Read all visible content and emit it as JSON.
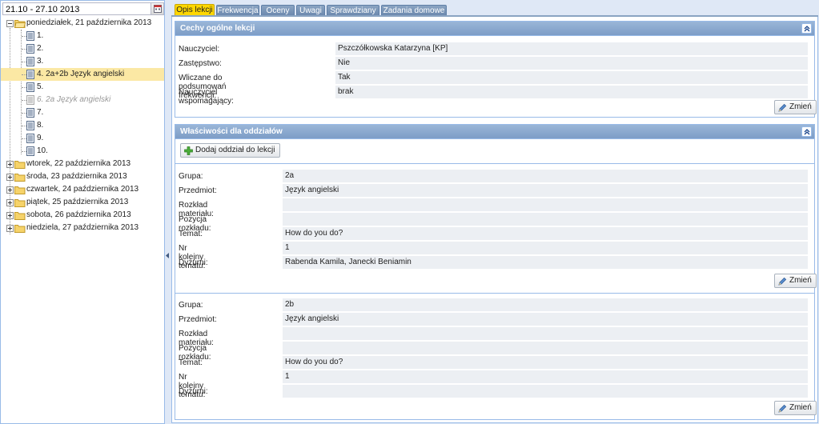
{
  "week": {
    "range": "21.10 - 27.10 2013"
  },
  "tree": {
    "days": [
      {
        "label": "poniedziałek, 21 października 2013",
        "expanded": true
      },
      {
        "label": "wtorek, 22 października 2013",
        "expanded": false
      },
      {
        "label": "środa, 23 października 2013",
        "expanded": false
      },
      {
        "label": "czwartek, 24 października 2013",
        "expanded": false
      },
      {
        "label": "piątek, 25 października 2013",
        "expanded": false
      },
      {
        "label": "sobota, 26 października 2013",
        "expanded": false
      },
      {
        "label": "niedziela, 27 października 2013",
        "expanded": false
      }
    ],
    "lessons": [
      {
        "label": "1."
      },
      {
        "label": "2."
      },
      {
        "label": "3."
      },
      {
        "label": "4. 2a+2b Język angielski",
        "selected": true
      },
      {
        "label": "5."
      },
      {
        "label": "6. 2a Język angielski",
        "cancelled": true
      },
      {
        "label": "7."
      },
      {
        "label": "8."
      },
      {
        "label": "9."
      },
      {
        "label": "10."
      }
    ]
  },
  "tabs": [
    {
      "label": "Opis lekcji",
      "active": true
    },
    {
      "label": "Frekwencja"
    },
    {
      "label": "Oceny"
    },
    {
      "label": "Uwagi"
    },
    {
      "label": "Sprawdziany"
    },
    {
      "label": "Zadania domowe"
    }
  ],
  "general": {
    "title": "Cechy ogólne lekcji",
    "rows": [
      {
        "key": "Nauczyciel:",
        "value": "Pszczółkowska Katarzyna [KP]"
      },
      {
        "key": "Zastępstwo:",
        "value": "Nie"
      },
      {
        "key": "Wliczane do podsumowań frekwencji:",
        "value": "Tak"
      },
      {
        "key": "Nauczyciel wspomagający:",
        "value": "brak"
      }
    ],
    "change_label": "Zmień"
  },
  "groups": {
    "title": "Właściwości dla oddziałów",
    "add_label": "Dodaj oddział do lekcji",
    "change_label": "Zmień",
    "items": [
      {
        "rows": [
          {
            "key": "Grupa:",
            "value": "2a"
          },
          {
            "key": "Przedmiot:",
            "value": "Język angielski"
          },
          {
            "key": "Rozkład materiału:",
            "value": ""
          },
          {
            "key": "Pozycja rozkładu:",
            "value": ""
          },
          {
            "key": "Temat:",
            "value": "How do you do?"
          },
          {
            "key": "Nr kolejny tematu:",
            "value": "1"
          },
          {
            "key": "Dyżurni:",
            "value": "Rabenda Kamila, Janecki Beniamin"
          }
        ]
      },
      {
        "rows": [
          {
            "key": "Grupa:",
            "value": "2b"
          },
          {
            "key": "Przedmiot:",
            "value": "Język angielski"
          },
          {
            "key": "Rozkład materiału:",
            "value": ""
          },
          {
            "key": "Pozycja rozkładu:",
            "value": ""
          },
          {
            "key": "Temat:",
            "value": "How do you do?"
          },
          {
            "key": "Nr kolejny tematu:",
            "value": "1"
          },
          {
            "key": "Dyżurni:",
            "value": ""
          }
        ]
      }
    ]
  },
  "colors": {
    "accent": "#ffd700",
    "panel_header": "#7d9dc7",
    "selected_row": "#fbe8a4",
    "value_bg": "#eceff3"
  }
}
